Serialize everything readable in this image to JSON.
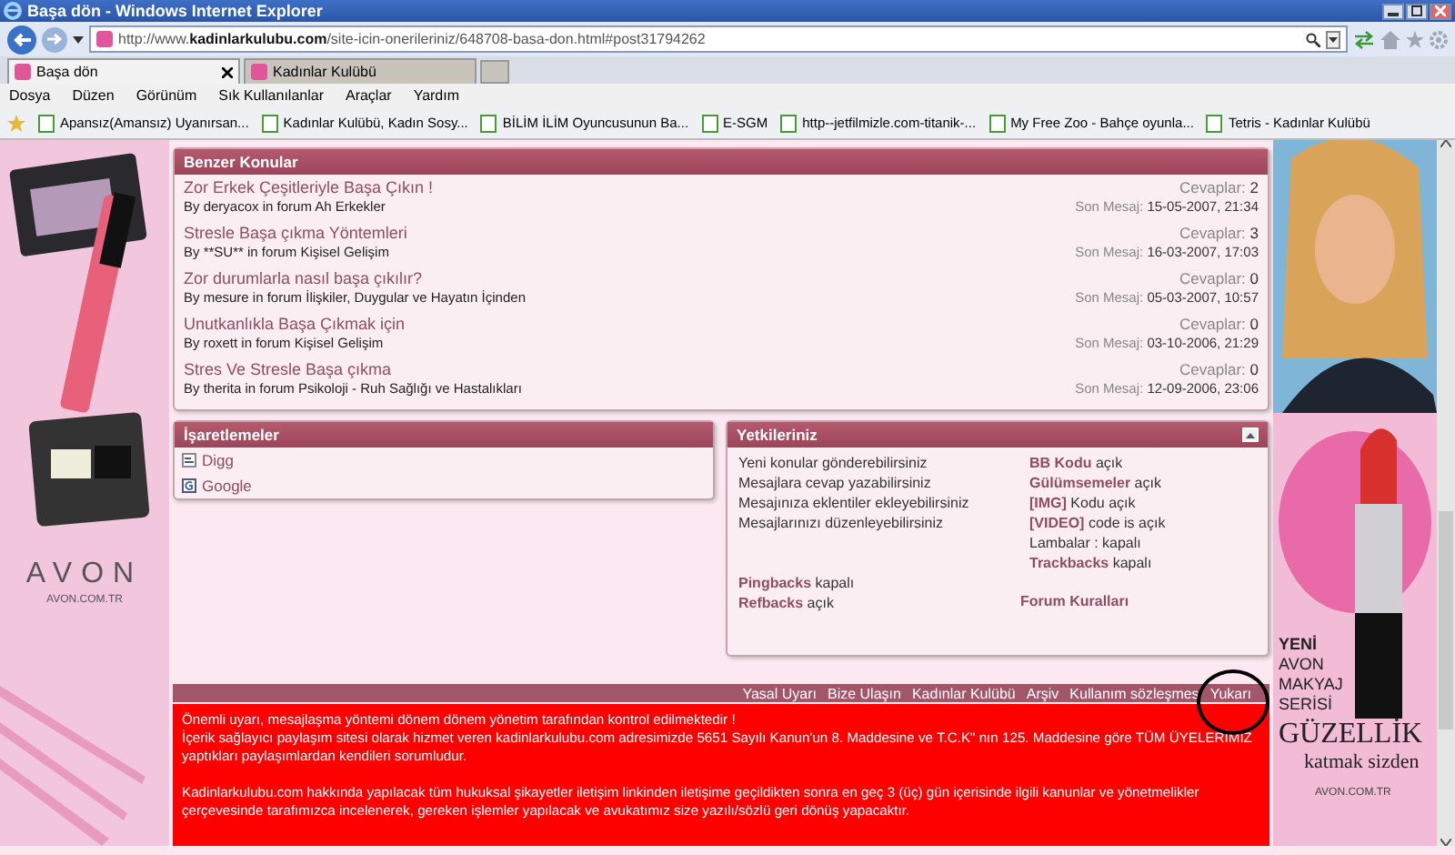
{
  "window": {
    "title": "Başa dön - Windows Internet Explorer"
  },
  "address_bar": {
    "url": "http://www.**kadinlarkulubu.com**/site-icin-onerileriniz/648708-basa-don.html#post31794262"
  },
  "tabs": [
    {
      "label": "Başa dön",
      "selected": true
    },
    {
      "label": "Kadınlar Kulübü",
      "selected": false
    }
  ],
  "menu": [
    "Dosya",
    "Düzen",
    "Görünüm",
    "Sık Kullanılanlar",
    "Araçlar",
    "Yardım"
  ],
  "favorites": [
    "Apansız(Amansız) Uyanırsan...",
    "Kadınlar Kulübü, Kadın Sosy...",
    "BİLİM İLİM Oyuncusunun Ba...",
    "E-SGM",
    "http--jetfilmizle.com-titanik-...",
    "My Free Zoo - Bahçe oyunla...",
    "Tetris - Kadınlar Kulübü"
  ],
  "left_ad": {
    "brand": "AVON",
    "site": "AVON.COM.TR"
  },
  "similar_threads": {
    "title": "Benzer Konular",
    "threads": [
      {
        "title": "Zor Erkek Çeşitleriyle Başa Çıkın !",
        "byline": "By deryacox in forum Ah Erkekler",
        "replies_label": "Cevaplar:",
        "replies": "2",
        "last_label": "Son Mesaj:",
        "last_post": "15-05-2007, 21:34"
      },
      {
        "title": "Stresle Başa çıkma Yöntemleri",
        "byline": "By **SU** in forum Kişisel Gelişim",
        "replies_label": "Cevaplar:",
        "replies": "3",
        "last_label": "Son Mesaj:",
        "last_post": "16-03-2007, 17:03"
      },
      {
        "title": "Zor durumlarla nasıl başa çıkılır?",
        "byline": "By mesure in forum İlişkiler, Duygular ve Hayatın İçinden",
        "replies_label": "Cevaplar:",
        "replies": "0",
        "last_label": "Son Mesaj:",
        "last_post": "05-03-2007, 10:57"
      },
      {
        "title": "Unutkanlıkla Başa Çıkmak için",
        "byline": "By roxett in forum Kişisel Gelişim",
        "replies_label": "Cevaplar:",
        "replies": "0",
        "last_label": "Son Mesaj:",
        "last_post": "03-10-2006, 21:29"
      },
      {
        "title": "Stres Ve Stresle Başa çıkma",
        "byline": "By therita in forum Psikoloji - Ruh Sağlığı ve Hastalıkları",
        "replies_label": "Cevaplar:",
        "replies": "0",
        "last_label": "Son Mesaj:",
        "last_post": "12-09-2006, 23:06"
      }
    ]
  },
  "bookmarks": {
    "title": "İşaretlemeler",
    "items": [
      {
        "label": "Digg",
        "kind": "digg"
      },
      {
        "label": "Google",
        "kind": "google"
      }
    ]
  },
  "permissions": {
    "title": "Yetkileriniz",
    "expanded": true,
    "rights": [
      "Yeni konular gönderebilirsiniz",
      "Mesajlara cevap yazabilirsiniz",
      "Mesajınıza eklentiler ekleyebilirsiniz",
      "Mesajlarınızı düzenleyebilirsiniz"
    ],
    "codes": [
      "**BB Kodu** açık",
      "**Gülümsemeler** açık",
      "**[IMG]** Kodu açık",
      "**[VIDEO]** code is açık",
      "Lambalar : kapalı",
      "**Trackbacks** kapalı"
    ],
    "backs": [
      "**Pingbacks** kapalı",
      "**Refbacks** açık"
    ],
    "rules_link": "Forum Kuralları"
  },
  "footer_links": [
    "Yasal Uyarı",
    "Bize Ulaşın",
    "Kadınlar Kulübü",
    "Arşiv",
    "Kullanım sözleşmes",
    "Yukarı"
  ],
  "notice": [
    "Önemli uyarı, mesajlaşma yöntemi dönem dönem yönetim tarafından kontrol edilmektedir !\nİçerik sağlayıcı paylaşım sitesi olarak hizmet veren kadinlarkulubu.com adresimizde 5651 Sayılı Kanun'un 8. Maddesine ve T.C.K\" nın 125. Maddesine göre TÜM ÜYELERİMİZ yaptıkları paylaşımlardan kendileri sorumludur.",
    "Kadinlarkulubu.com hakkında yapılacak tüm hukuksal şikayetler iletişim linkinden iletişime geçildikten sonra en geç 3 (üç) gün içerisinde ilgili kanunlar ve yönetmelikler çerçevesinde tarafımızca incelenerek, gereken işlemler yapılacak ve avukatımız size yazılı/sözlü geri dönüş yapacaktır."
  ],
  "right_ad": {
    "lines": [
      "YENİ",
      "AVON",
      "MAKYAJ",
      "SERİSİ"
    ],
    "headline": "GÜZELLİK",
    "tagline": "katmak sizden",
    "site": "AVON.COM.TR"
  }
}
